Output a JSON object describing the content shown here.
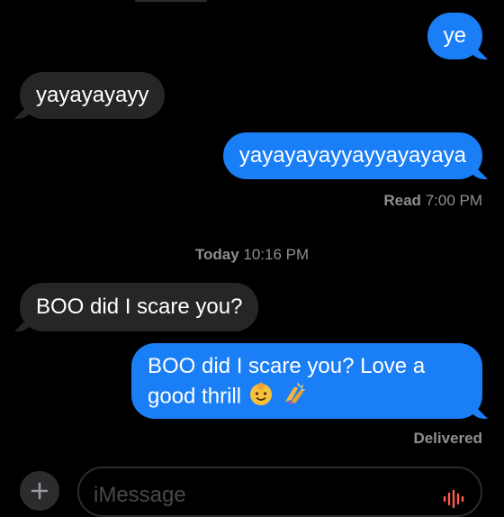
{
  "conversation": {
    "messages": [
      {
        "direction": "sent",
        "text": "ye"
      },
      {
        "direction": "received",
        "text": "yayayayayy"
      },
      {
        "direction": "sent",
        "text": "yayayayayyayyayayaya"
      },
      {
        "direction": "received",
        "text": "BOO did I scare you?"
      },
      {
        "direction": "sent",
        "text": "BOO did I scare you? Love a good thrill"
      }
    ],
    "read_receipt": {
      "label": "Read",
      "time": "7:00 PM"
    },
    "day_separator": {
      "day": "Today",
      "time": "10:16 PM"
    },
    "delivered_label": "Delivered"
  },
  "composer": {
    "placeholder": "iMessage",
    "plus_icon": "plus-icon",
    "audio_icon": "audio-waveform-icon"
  },
  "colors": {
    "sent_bubble": "#1a7ef7",
    "received_bubble": "#262628",
    "background": "#000000",
    "meta_text": "#8e8e93"
  }
}
